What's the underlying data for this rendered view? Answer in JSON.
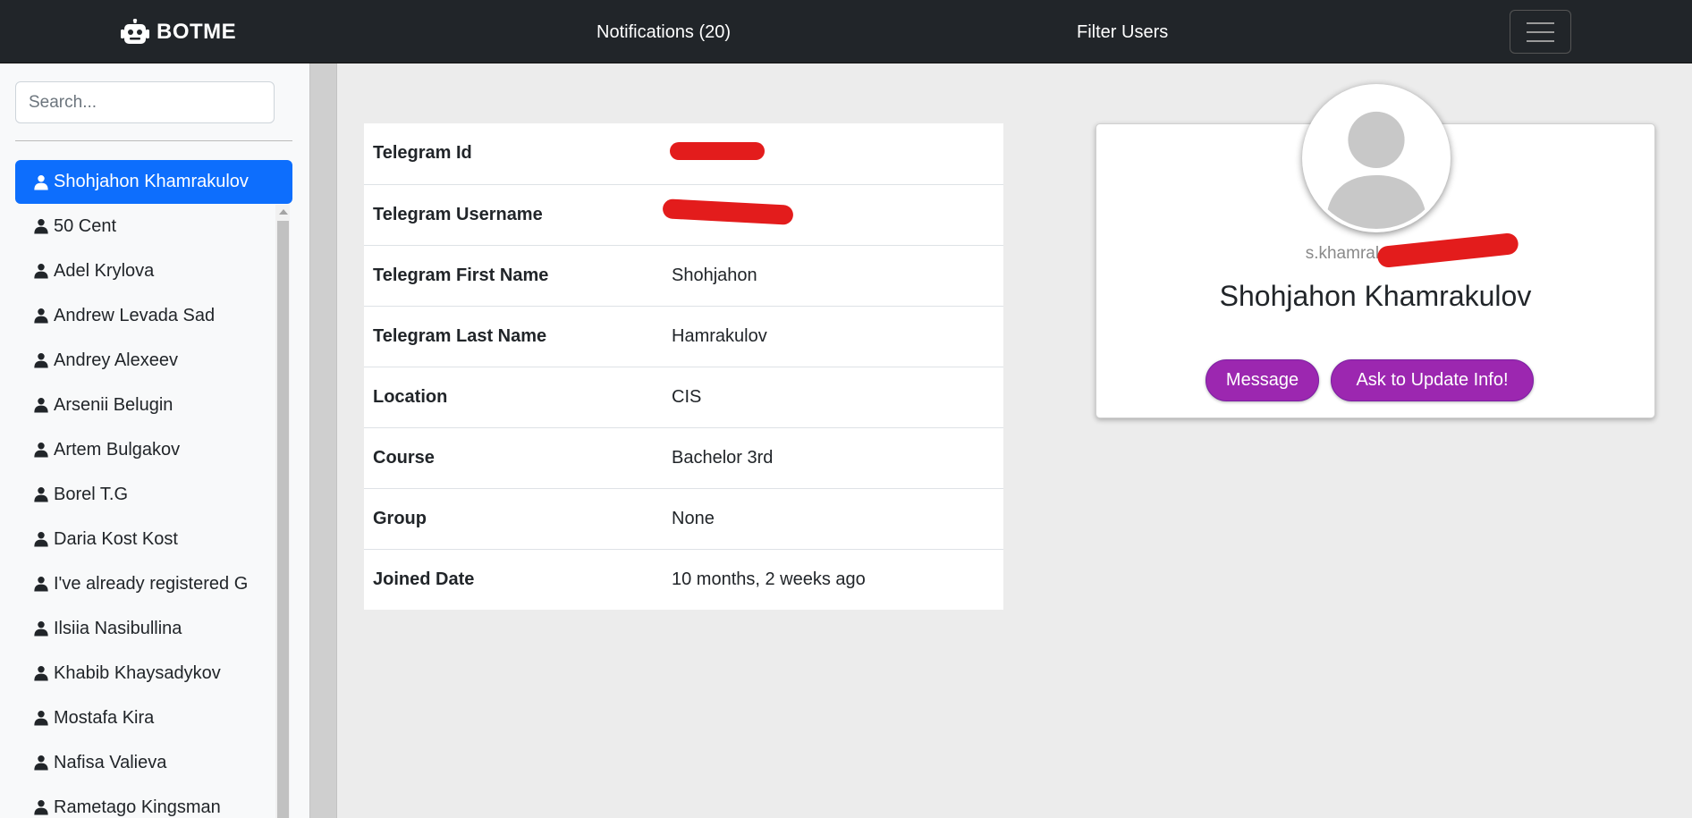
{
  "navbar": {
    "brand": "BOTME",
    "notifications_label": "Notifications (20)",
    "filter_label": "Filter Users"
  },
  "sidebar": {
    "search_placeholder": "Search...",
    "active_user": "Shohjahon Khamrakulov",
    "users": [
      "50 Cent",
      "Adel Krylova",
      "Andrew Levada Sad",
      "Andrey Alexeev",
      "Arsenii Belugin",
      "Artem Bulgakov",
      "Borel T.G",
      "Daria Kost Kost",
      "I've already registered G",
      "Ilsiia Nasibullina",
      "Khabib Khaysadykov",
      "Mostafa Kira",
      "Nafisa Valieva",
      "Rametago Kingsman"
    ]
  },
  "details": {
    "rows": [
      {
        "label": "Telegram Id",
        "value": ""
      },
      {
        "label": "Telegram Username",
        "value": ""
      },
      {
        "label": "Telegram First Name",
        "value": "Shohjahon"
      },
      {
        "label": "Telegram Last Name",
        "value": "Hamrakulov"
      },
      {
        "label": "Location",
        "value": "CIS"
      },
      {
        "label": "Course",
        "value": "Bachelor 3rd"
      },
      {
        "label": "Group",
        "value": "None"
      },
      {
        "label": "Joined Date",
        "value": "10 months, 2 weeks ago"
      }
    ]
  },
  "profile": {
    "email_visible": "s.khamrakulov@in",
    "name": "Shohjahon Khamrakulov",
    "message_button": "Message",
    "update_button": "Ask to Update Info!"
  },
  "colors": {
    "navbar_bg": "#212529",
    "active_user_bg": "#0d6efd",
    "button_purple": "#9c27b0",
    "redaction_red": "#e31c1c"
  },
  "icons": {
    "brand": "robot-icon",
    "user": "person-icon",
    "menu": "hamburger-icon",
    "avatar": "default-avatar-icon"
  }
}
